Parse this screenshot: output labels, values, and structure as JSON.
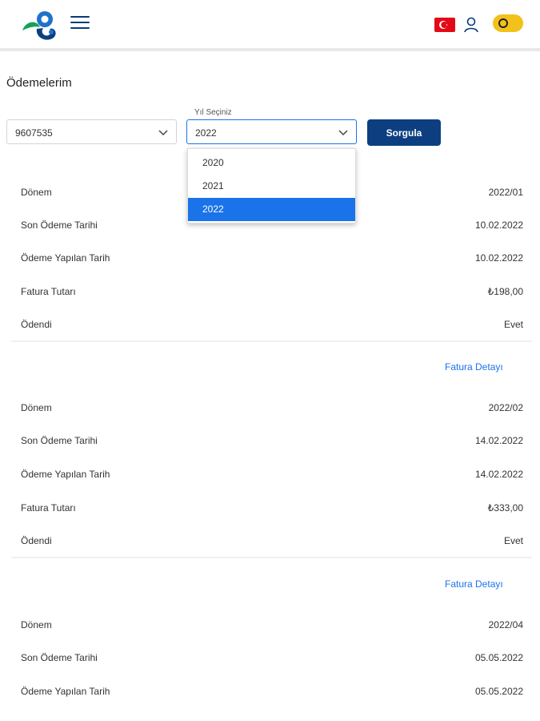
{
  "header": {
    "logo_icon": "logo-icon",
    "menu_icon": "hamburger-menu-icon",
    "flag_icon": "turkey-flag-icon",
    "user_icon": "user-icon",
    "theme_icon": "theme-toggle-icon",
    "accent_color": "#0d3f80",
    "toggle_color": "#f2c21a"
  },
  "page": {
    "title": "Ödemelerim"
  },
  "filters": {
    "subscriber_select_value": "9607535",
    "year_label": "Yıl Seçiniz",
    "year_select_value": "2022",
    "query_button": "Sorgula",
    "year_options": [
      "2020",
      "2021",
      "2022"
    ],
    "selected_year_option": "2022"
  },
  "labels": {
    "period": "Dönem",
    "due_date": "Son Ödeme Tarihi",
    "paid_date": "Ödeme Yapılan Tarih",
    "amount": "Fatura Tutarı",
    "paid": "Ödendi",
    "detail_link": "Fatura Detayı"
  },
  "bills": [
    {
      "period": "2022/01",
      "due_date": "10.02.2022",
      "paid_date": "10.02.2022",
      "amount": "₺198,00",
      "paid": "Evet"
    },
    {
      "period": "2022/02",
      "due_date": "14.02.2022",
      "paid_date": "14.02.2022",
      "amount": "₺333,00",
      "paid": "Evet"
    },
    {
      "period": "2022/04",
      "due_date": "05.05.2022",
      "paid_date": "05.05.2022"
    }
  ]
}
